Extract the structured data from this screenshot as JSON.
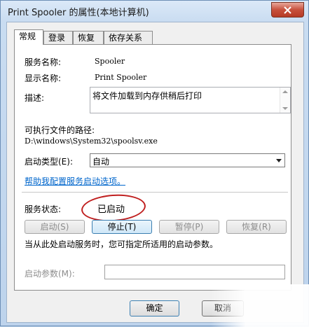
{
  "window": {
    "title": "Print Spooler 的属性(本地计算机)"
  },
  "tabs": [
    {
      "label": "常规",
      "active": true
    },
    {
      "label": "登录",
      "active": false
    },
    {
      "label": "恢复",
      "active": false
    },
    {
      "label": "依存关系",
      "active": false
    }
  ],
  "general": {
    "service_name_label": "服务名称:",
    "service_name_value": "Spooler",
    "display_name_label": "显示名称:",
    "display_name_value": "Print Spooler",
    "description_label": "描述:",
    "description_value": "将文件加载到内存供稍后打印",
    "exe_path_label": "可执行文件的路径:",
    "exe_path_value": "D:\\windows\\System32\\spoolsv.exe",
    "startup_type_label": "启动类型(E):",
    "startup_type_value": "自动",
    "help_link": "帮助我配置服务启动选项。",
    "status_label": "服务状态:",
    "status_value": "已启动",
    "buttons": {
      "start": "启动(S)",
      "stop": "停止(T)",
      "pause": "暂停(P)",
      "resume": "恢复(R)"
    },
    "note": "当从此处启动服务时，您可指定所适用的启动参数。",
    "start_params_label": "启动参数(M):",
    "start_params_value": ""
  },
  "footer": {
    "ok": "确定",
    "cancel": "取消"
  },
  "colors": {
    "annotation": "#c01f1f",
    "link": "#0066cc"
  }
}
